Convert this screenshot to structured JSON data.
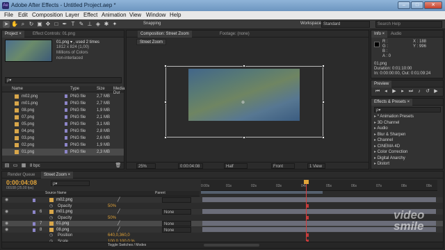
{
  "window": {
    "title": "Adobe After Effects - Untitled Project.aep *",
    "app_icon_text": "Ae"
  },
  "menu": [
    "File",
    "Edit",
    "Composition",
    "Layer",
    "Effect",
    "Animation",
    "View",
    "Window",
    "Help"
  ],
  "toolbar": {
    "snapping_label": "Snapping",
    "workspace_label": "Workspace:",
    "workspace_value": "Standard",
    "search_placeholder": "Search Help"
  },
  "project_panel": {
    "tab_project": "Project ×",
    "tab_effect_controls": "Effect Controls: 01.png",
    "selected_name": "01.png ▾ , used 2 times",
    "selected_dims": "1812 x 824 (1,00)",
    "selected_colors": "Millions of Colors",
    "selected_interlace": "non-interlaced",
    "search_placeholder": "ρ▾",
    "columns": {
      "name": "Name",
      "type": "Type",
      "size": "Size",
      "media": "Media Dur"
    },
    "items": [
      {
        "name": "m02.png",
        "type": "PNG file",
        "size": "2,7 MB"
      },
      {
        "name": "m01.png",
        "type": "PNG file",
        "size": "2,7 MB"
      },
      {
        "name": "08.png",
        "type": "PNG file",
        "size": "1,9 MB"
      },
      {
        "name": "07.png",
        "type": "PNG file",
        "size": "2,1 MB"
      },
      {
        "name": "05.png",
        "type": "PNG file",
        "size": "3,1 MB"
      },
      {
        "name": "04.png",
        "type": "PNG file",
        "size": "2,8 MB"
      },
      {
        "name": "03.png",
        "type": "PNG file",
        "size": "2,6 MB"
      },
      {
        "name": "02.png",
        "type": "PNG file",
        "size": "1,9 MB"
      },
      {
        "name": "01.png",
        "type": "PNG file",
        "size": "2,3 MB"
      }
    ],
    "footer_bpc": "8 bpc"
  },
  "comp_panel": {
    "tab_comp": "Composition: Street Zoom",
    "tab_footage": "Footage: (none)",
    "breadcrumb": "Street Zoom",
    "zoom": "25%",
    "timecode": "0:00:04:08",
    "resolution": "Half",
    "view": "Front",
    "views_count": "1 View"
  },
  "info_panel": {
    "tab_info": "Info ×",
    "tab_audio": "Audio",
    "r": "R :",
    "g": "G :",
    "b": "B :",
    "a": "A : 0",
    "x": "X : 188",
    "y": "Y : 996",
    "name": "01.png",
    "duration": "Duration: 0:01:10:00",
    "in_out": "In: 0:00:00:00, Out: 0:01:09:24"
  },
  "preview_panel": {
    "tab": "Preview"
  },
  "effects_panel": {
    "tab": "Effects & Presets ×",
    "search_placeholder": "ρ▾",
    "categories": [
      "* Animation Presets",
      "3D Channel",
      "Audio",
      "Blur & Sharpen",
      "Channel",
      "CINEMA 4D",
      "Color Correction",
      "Digital Anarchy",
      "Distort"
    ]
  },
  "timeline": {
    "tab_render": "Render Queue",
    "tab_comp": "Street Zoom ×",
    "timecode": "0:00:04:08",
    "timecode_sub": "00108 (25.00 fps)",
    "search_placeholder": "ρ▾",
    "col_source": "Source Name",
    "col_parent": "Parent",
    "ruler": [
      "0:00s",
      "01s",
      "02s",
      "03s",
      "04s",
      "05s",
      "06s",
      "07s",
      "08s",
      "09s"
    ],
    "layers": [
      {
        "num": "",
        "name": "m02.png",
        "sub": "Opacity",
        "sub_val": "50%",
        "parent": ""
      },
      {
        "num": "6",
        "name": "m01.png",
        "sub": "Opacity",
        "sub_val": "50%",
        "parent": "None"
      },
      {
        "num": "7",
        "name": "01.png",
        "sub": "",
        "sub_val": "",
        "parent": "None"
      },
      {
        "num": "8",
        "name": "08.png",
        "sub": "Position",
        "sub_val": "640,0,360,0",
        "parent": "None"
      },
      {
        "num": "",
        "name": "",
        "sub": "Scale",
        "sub_val": "100,0,100,0 %",
        "parent": ""
      }
    ],
    "footer": "Toggle Switches / Modes"
  },
  "watermark": {
    "line1": "video",
    "line2": "smile"
  }
}
